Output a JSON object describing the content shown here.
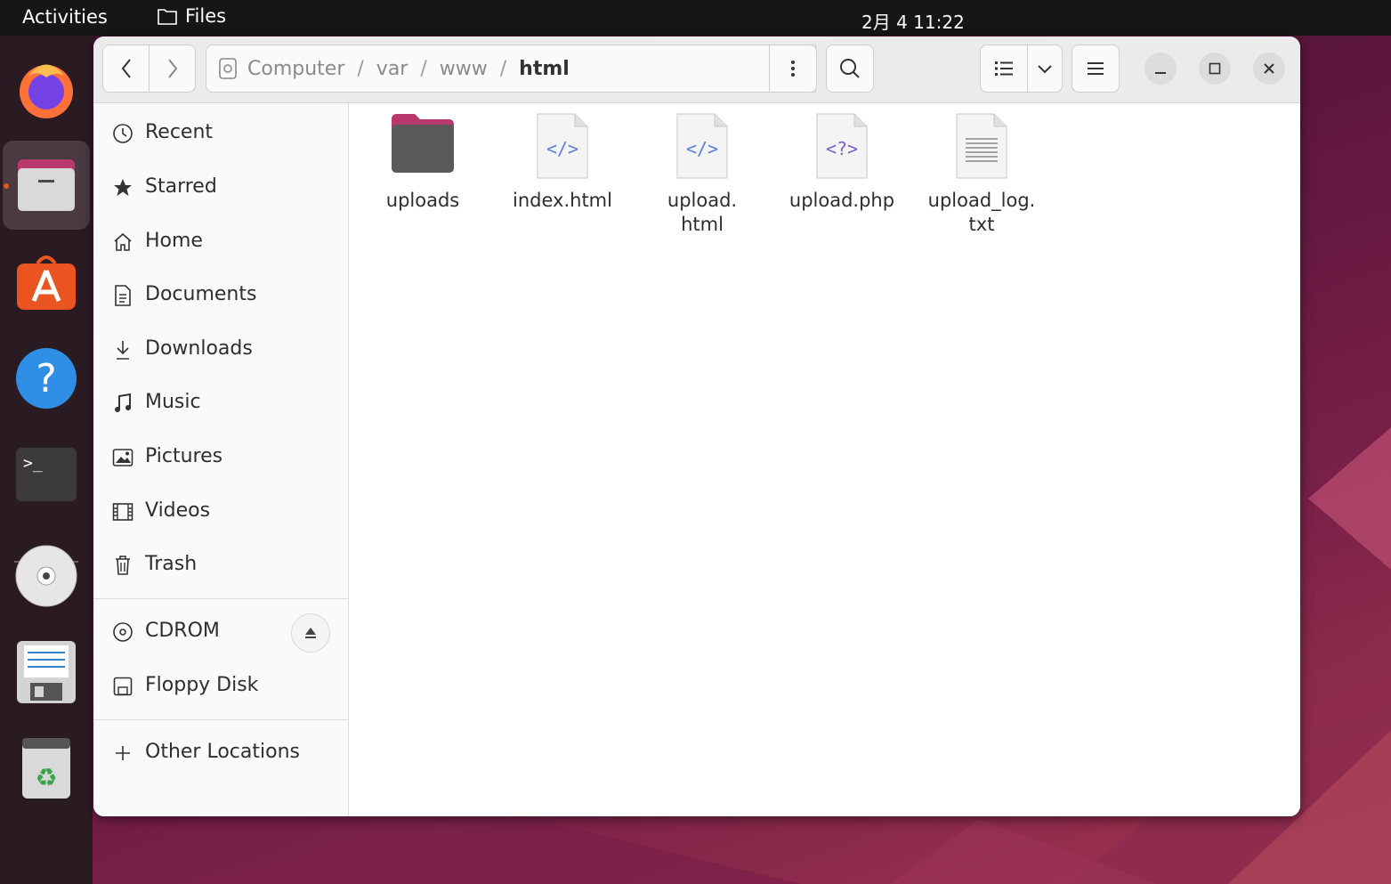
{
  "topbar": {
    "activities": "Activities",
    "app_name": "Files",
    "clock": "2月 4  11:22"
  },
  "dock": {
    "items": [
      {
        "name": "firefox",
        "icon": "firefox-icon"
      },
      {
        "name": "files",
        "icon": "files-icon",
        "running": true
      },
      {
        "name": "app-center",
        "icon": "app-center-icon"
      },
      {
        "name": "help",
        "icon": "help-icon"
      },
      {
        "name": "terminal",
        "icon": "terminal-icon"
      },
      {
        "name": "cdrom",
        "icon": "cdrom-icon"
      },
      {
        "name": "floppy",
        "icon": "floppy-icon"
      },
      {
        "name": "trash",
        "icon": "trash-icon"
      }
    ]
  },
  "headerbar": {
    "path": [
      "Computer",
      "var",
      "www",
      "html"
    ]
  },
  "sidebar": {
    "places": [
      {
        "label": "Recent",
        "icon": "clock-icon"
      },
      {
        "label": "Starred",
        "icon": "star-icon"
      },
      {
        "label": "Home",
        "icon": "home-icon"
      },
      {
        "label": "Documents",
        "icon": "document-icon"
      },
      {
        "label": "Downloads",
        "icon": "download-icon"
      },
      {
        "label": "Music",
        "icon": "music-icon"
      },
      {
        "label": "Pictures",
        "icon": "picture-icon"
      },
      {
        "label": "Videos",
        "icon": "video-icon"
      },
      {
        "label": "Trash",
        "icon": "trash-icon"
      }
    ],
    "devices": [
      {
        "label": "CDROM",
        "icon": "disc-icon"
      },
      {
        "label": "Floppy Disk",
        "icon": "floppy-icon"
      }
    ],
    "other": {
      "label": "Other Locations",
      "icon": "plus-icon"
    }
  },
  "files": [
    {
      "name_line1": "uploads",
      "name_line2": "",
      "type": "folder"
    },
    {
      "name_line1": "index.html",
      "name_line2": "",
      "type": "html",
      "glyph": "</>"
    },
    {
      "name_line1": "upload.",
      "name_line2": "html",
      "type": "html",
      "glyph": "</>"
    },
    {
      "name_line1": "upload.php",
      "name_line2": "",
      "type": "php",
      "glyph": "<?>"
    },
    {
      "name_line1": "upload_log.",
      "name_line2": "txt",
      "type": "text"
    }
  ],
  "colors": {
    "accent": "#e95420",
    "code_glyph": "#5a7ee0",
    "php_glyph": "#7b5fd0"
  }
}
